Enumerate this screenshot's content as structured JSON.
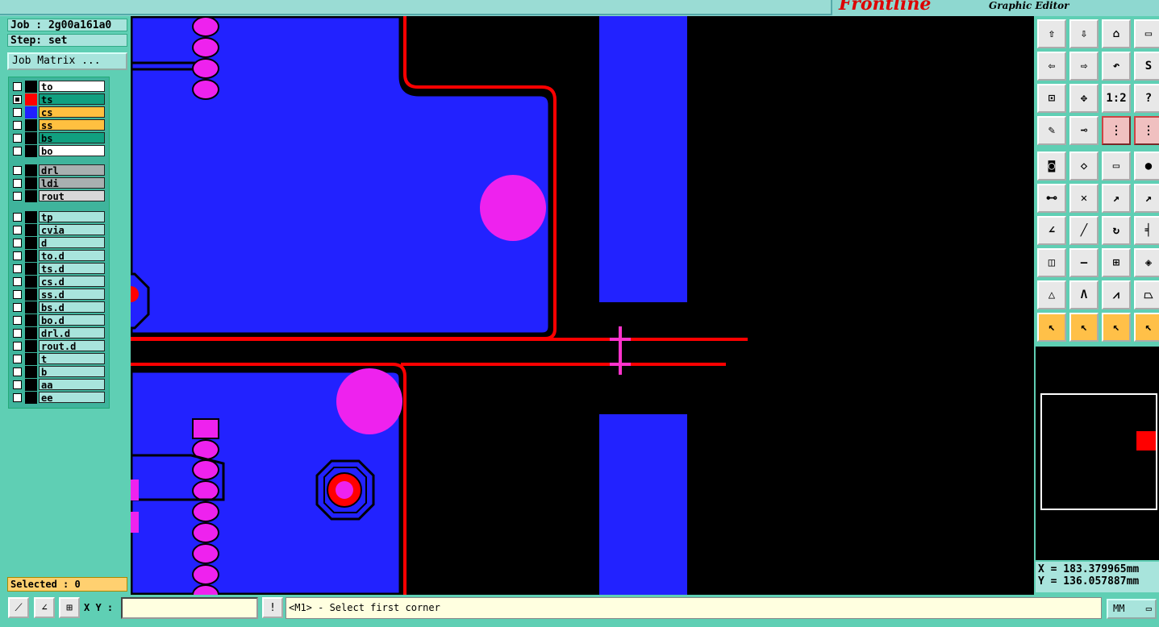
{
  "app": {
    "logo_text": "Frontline",
    "subtitle": "Graphic Editor"
  },
  "info": {
    "job": "Job : 2g00a161a0",
    "step": "Step: set",
    "job_matrix_label": "Job Matrix ..."
  },
  "layers": {
    "group1": [
      {
        "name": "to",
        "color": "#ffffff",
        "swatch": "#000000",
        "checked": false
      },
      {
        "name": "ts",
        "color": "#10a080",
        "swatch": "#ff0000",
        "checked": true
      },
      {
        "name": "cs",
        "color": "#ffc040",
        "swatch": "#2020ff",
        "checked": false
      },
      {
        "name": "ss",
        "color": "#ffc040",
        "swatch": "#000000",
        "checked": false
      },
      {
        "name": "bs",
        "color": "#10a080",
        "swatch": "#000000",
        "checked": false
      },
      {
        "name": "bo",
        "color": "#ffffff",
        "swatch": "#000000",
        "checked": false
      }
    ],
    "group2": [
      {
        "name": "drl",
        "color": "#a8b0b0",
        "swatch": "#000000",
        "checked": false
      },
      {
        "name": "ldi",
        "color": "#a8b0b0",
        "swatch": "#000000",
        "checked": false
      },
      {
        "name": "rout",
        "color": "#d8d8d8",
        "swatch": "#000000",
        "checked": false
      }
    ],
    "group3": [
      {
        "name": "tp",
        "color": "#a8e4dc",
        "swatch": "#000000",
        "checked": false
      },
      {
        "name": "cvia",
        "color": "#a8e4dc",
        "swatch": "#000000",
        "checked": false
      },
      {
        "name": "d",
        "color": "#a8e4dc",
        "swatch": "#000000",
        "checked": false
      },
      {
        "name": "to.d",
        "color": "#a8e4dc",
        "swatch": "#000000",
        "checked": false
      },
      {
        "name": "ts.d",
        "color": "#a8e4dc",
        "swatch": "#000000",
        "checked": false
      },
      {
        "name": "cs.d",
        "color": "#a8e4dc",
        "swatch": "#000000",
        "checked": false
      },
      {
        "name": "ss.d",
        "color": "#a8e4dc",
        "swatch": "#000000",
        "checked": false
      },
      {
        "name": "bs.d",
        "color": "#a8e4dc",
        "swatch": "#000000",
        "checked": false
      },
      {
        "name": "bo.d",
        "color": "#a8e4dc",
        "swatch": "#000000",
        "checked": false
      },
      {
        "name": "drl.d",
        "color": "#a8e4dc",
        "swatch": "#000000",
        "checked": false
      },
      {
        "name": "rout.d",
        "color": "#a8e4dc",
        "swatch": "#000000",
        "checked": false
      },
      {
        "name": "t",
        "color": "#a8e4dc",
        "swatch": "#000000",
        "checked": false
      },
      {
        "name": "b",
        "color": "#a8e4dc",
        "swatch": "#000000",
        "checked": false
      },
      {
        "name": "aa",
        "color": "#a8e4dc",
        "swatch": "#000000",
        "checked": false
      },
      {
        "name": "ee",
        "color": "#a8e4dc",
        "swatch": "#000000",
        "checked": false
      }
    ]
  },
  "selected": "Selected : 0",
  "coords": {
    "x": "X = 183.379965mm",
    "y": "Y = 136.057887mm"
  },
  "toolbar": {
    "buttons": [
      {
        "name": "move-up-icon",
        "glyph": "⇧"
      },
      {
        "name": "move-down-icon",
        "glyph": "⇩"
      },
      {
        "name": "home-icon",
        "glyph": "⌂"
      },
      {
        "name": "window-icon",
        "glyph": "▭"
      },
      {
        "name": "pan-left-icon",
        "glyph": "⇦"
      },
      {
        "name": "pan-right-icon",
        "glyph": "⇨"
      },
      {
        "name": "undo-zoom-icon",
        "glyph": "↶"
      },
      {
        "name": "redraw-icon",
        "glyph": "S"
      },
      {
        "name": "zoom-fit-icon",
        "glyph": "⊡"
      },
      {
        "name": "zoom-center-icon",
        "glyph": "✥"
      },
      {
        "name": "scale-icon",
        "glyph": "1:2"
      },
      {
        "name": "help-icon",
        "glyph": "?"
      },
      {
        "name": "tools-icon",
        "glyph": "✎"
      },
      {
        "name": "probe-icon",
        "glyph": "⊸"
      },
      {
        "name": "netlist-icon",
        "glyph": "⋮"
      },
      {
        "name": "net-compare-icon",
        "glyph": "⋮"
      },
      {
        "name": "pad-icon",
        "glyph": "◙"
      },
      {
        "name": "outline-icon",
        "glyph": "◇"
      },
      {
        "name": "ruler-icon",
        "glyph": "▭"
      },
      {
        "name": "dot-icon",
        "glyph": "●"
      },
      {
        "name": "connect-icon",
        "glyph": "⊷"
      },
      {
        "name": "cross-icon",
        "glyph": "✕"
      },
      {
        "name": "snap-icon",
        "glyph": "↗"
      },
      {
        "name": "snap-arrow-icon",
        "glyph": "↗"
      },
      {
        "name": "angle-icon",
        "glyph": "∠"
      },
      {
        "name": "line-icon",
        "glyph": "╱"
      },
      {
        "name": "rotate-icon",
        "glyph": "↻"
      },
      {
        "name": "mirror-icon",
        "glyph": "╡"
      },
      {
        "name": "copy-icon",
        "glyph": "◫"
      },
      {
        "name": "break-icon",
        "glyph": "—"
      },
      {
        "name": "measure-icon",
        "glyph": "⊞"
      },
      {
        "name": "merge-icon",
        "glyph": "◈"
      },
      {
        "name": "triangle-icon",
        "glyph": "△"
      },
      {
        "name": "arch-icon",
        "glyph": "Λ"
      },
      {
        "name": "bridge-icon",
        "glyph": "⩘"
      },
      {
        "name": "trapezoid-icon",
        "glyph": "⏢"
      },
      {
        "name": "select-icon",
        "glyph": "↖"
      },
      {
        "name": "select-box-icon",
        "glyph": "↖"
      },
      {
        "name": "select-diamond-icon",
        "glyph": "↖"
      },
      {
        "name": "select-route-icon",
        "glyph": "↖"
      }
    ]
  },
  "bottombar": {
    "xy_label": "X Y :",
    "xy_value": "",
    "status_text": "<M1> - Select first corner",
    "units": "MM"
  }
}
